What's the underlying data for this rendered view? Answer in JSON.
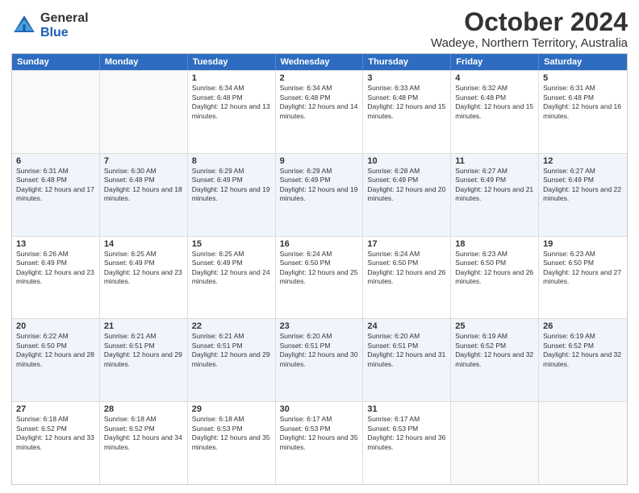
{
  "logo": {
    "general": "General",
    "blue": "Blue"
  },
  "title": "October 2024",
  "subtitle": "Wadeye, Northern Territory, Australia",
  "days": [
    "Sunday",
    "Monday",
    "Tuesday",
    "Wednesday",
    "Thursday",
    "Friday",
    "Saturday"
  ],
  "weeks": [
    [
      {
        "day": "",
        "sunrise": "",
        "sunset": "",
        "daylight": ""
      },
      {
        "day": "",
        "sunrise": "",
        "sunset": "",
        "daylight": ""
      },
      {
        "day": "1",
        "sunrise": "Sunrise: 6:34 AM",
        "sunset": "Sunset: 6:48 PM",
        "daylight": "Daylight: 12 hours and 13 minutes."
      },
      {
        "day": "2",
        "sunrise": "Sunrise: 6:34 AM",
        "sunset": "Sunset: 6:48 PM",
        "daylight": "Daylight: 12 hours and 14 minutes."
      },
      {
        "day": "3",
        "sunrise": "Sunrise: 6:33 AM",
        "sunset": "Sunset: 6:48 PM",
        "daylight": "Daylight: 12 hours and 15 minutes."
      },
      {
        "day": "4",
        "sunrise": "Sunrise: 6:32 AM",
        "sunset": "Sunset: 6:48 PM",
        "daylight": "Daylight: 12 hours and 15 minutes."
      },
      {
        "day": "5",
        "sunrise": "Sunrise: 6:31 AM",
        "sunset": "Sunset: 6:48 PM",
        "daylight": "Daylight: 12 hours and 16 minutes."
      }
    ],
    [
      {
        "day": "6",
        "sunrise": "Sunrise: 6:31 AM",
        "sunset": "Sunset: 6:48 PM",
        "daylight": "Daylight: 12 hours and 17 minutes."
      },
      {
        "day": "7",
        "sunrise": "Sunrise: 6:30 AM",
        "sunset": "Sunset: 6:48 PM",
        "daylight": "Daylight: 12 hours and 18 minutes."
      },
      {
        "day": "8",
        "sunrise": "Sunrise: 6:29 AM",
        "sunset": "Sunset: 6:49 PM",
        "daylight": "Daylight: 12 hours and 19 minutes."
      },
      {
        "day": "9",
        "sunrise": "Sunrise: 6:29 AM",
        "sunset": "Sunset: 6:49 PM",
        "daylight": "Daylight: 12 hours and 19 minutes."
      },
      {
        "day": "10",
        "sunrise": "Sunrise: 6:28 AM",
        "sunset": "Sunset: 6:49 PM",
        "daylight": "Daylight: 12 hours and 20 minutes."
      },
      {
        "day": "11",
        "sunrise": "Sunrise: 6:27 AM",
        "sunset": "Sunset: 6:49 PM",
        "daylight": "Daylight: 12 hours and 21 minutes."
      },
      {
        "day": "12",
        "sunrise": "Sunrise: 6:27 AM",
        "sunset": "Sunset: 6:49 PM",
        "daylight": "Daylight: 12 hours and 22 minutes."
      }
    ],
    [
      {
        "day": "13",
        "sunrise": "Sunrise: 6:26 AM",
        "sunset": "Sunset: 6:49 PM",
        "daylight": "Daylight: 12 hours and 23 minutes."
      },
      {
        "day": "14",
        "sunrise": "Sunrise: 6:25 AM",
        "sunset": "Sunset: 6:49 PM",
        "daylight": "Daylight: 12 hours and 23 minutes."
      },
      {
        "day": "15",
        "sunrise": "Sunrise: 6:25 AM",
        "sunset": "Sunset: 6:49 PM",
        "daylight": "Daylight: 12 hours and 24 minutes."
      },
      {
        "day": "16",
        "sunrise": "Sunrise: 6:24 AM",
        "sunset": "Sunset: 6:50 PM",
        "daylight": "Daylight: 12 hours and 25 minutes."
      },
      {
        "day": "17",
        "sunrise": "Sunrise: 6:24 AM",
        "sunset": "Sunset: 6:50 PM",
        "daylight": "Daylight: 12 hours and 26 minutes."
      },
      {
        "day": "18",
        "sunrise": "Sunrise: 6:23 AM",
        "sunset": "Sunset: 6:50 PM",
        "daylight": "Daylight: 12 hours and 26 minutes."
      },
      {
        "day": "19",
        "sunrise": "Sunrise: 6:23 AM",
        "sunset": "Sunset: 6:50 PM",
        "daylight": "Daylight: 12 hours and 27 minutes."
      }
    ],
    [
      {
        "day": "20",
        "sunrise": "Sunrise: 6:22 AM",
        "sunset": "Sunset: 6:50 PM",
        "daylight": "Daylight: 12 hours and 28 minutes."
      },
      {
        "day": "21",
        "sunrise": "Sunrise: 6:21 AM",
        "sunset": "Sunset: 6:51 PM",
        "daylight": "Daylight: 12 hours and 29 minutes."
      },
      {
        "day": "22",
        "sunrise": "Sunrise: 6:21 AM",
        "sunset": "Sunset: 6:51 PM",
        "daylight": "Daylight: 12 hours and 29 minutes."
      },
      {
        "day": "23",
        "sunrise": "Sunrise: 6:20 AM",
        "sunset": "Sunset: 6:51 PM",
        "daylight": "Daylight: 12 hours and 30 minutes."
      },
      {
        "day": "24",
        "sunrise": "Sunrise: 6:20 AM",
        "sunset": "Sunset: 6:51 PM",
        "daylight": "Daylight: 12 hours and 31 minutes."
      },
      {
        "day": "25",
        "sunrise": "Sunrise: 6:19 AM",
        "sunset": "Sunset: 6:52 PM",
        "daylight": "Daylight: 12 hours and 32 minutes."
      },
      {
        "day": "26",
        "sunrise": "Sunrise: 6:19 AM",
        "sunset": "Sunset: 6:52 PM",
        "daylight": "Daylight: 12 hours and 32 minutes."
      }
    ],
    [
      {
        "day": "27",
        "sunrise": "Sunrise: 6:18 AM",
        "sunset": "Sunset: 6:52 PM",
        "daylight": "Daylight: 12 hours and 33 minutes."
      },
      {
        "day": "28",
        "sunrise": "Sunrise: 6:18 AM",
        "sunset": "Sunset: 6:52 PM",
        "daylight": "Daylight: 12 hours and 34 minutes."
      },
      {
        "day": "29",
        "sunrise": "Sunrise: 6:18 AM",
        "sunset": "Sunset: 6:53 PM",
        "daylight": "Daylight: 12 hours and 35 minutes."
      },
      {
        "day": "30",
        "sunrise": "Sunrise: 6:17 AM",
        "sunset": "Sunset: 6:53 PM",
        "daylight": "Daylight: 12 hours and 35 minutes."
      },
      {
        "day": "31",
        "sunrise": "Sunrise: 6:17 AM",
        "sunset": "Sunset: 6:53 PM",
        "daylight": "Daylight: 12 hours and 36 minutes."
      },
      {
        "day": "",
        "sunrise": "",
        "sunset": "",
        "daylight": ""
      },
      {
        "day": "",
        "sunrise": "",
        "sunset": "",
        "daylight": ""
      }
    ]
  ]
}
